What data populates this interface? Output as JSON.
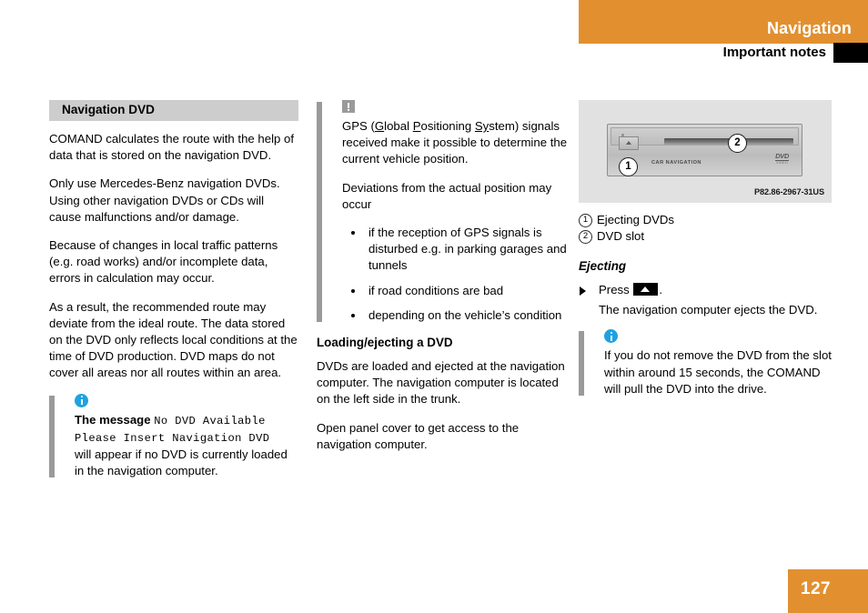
{
  "header": {
    "chapter_title": "Navigation",
    "section_title": "Important notes",
    "accent_color": "#e2902f"
  },
  "columns": {
    "left": {
      "section_band": "Navigation DVD",
      "paragraphs": [
        "COMAND calculates the route with the help of data that is stored on the navigation DVD.",
        "Only use Mercedes-Benz navigation DVDs. Using other navigation DVDs or CDs will cause malfunctions and/or damage.",
        "Because of changes in local traffic patterns (e.g. road works) and/or incomplete data, errors in calculation may occur.",
        "As a result, the recommended route may deviate from the ideal route. The data stored on the DVD only reflects local conditions at the time of DVD production. DVD maps do not cover all areas nor all routes within an area."
      ],
      "info_note": {
        "icon": "info-icon",
        "lead_bold": "The message",
        "message_line_1": "No DVD Available",
        "message_line_2": "Please Insert Navigation DVD",
        "tail": "will appear if no DVD is currently loaded in the navigation computer."
      }
    },
    "middle": {
      "warning_note": {
        "icon": "warning-icon",
        "paragraph_1_pre": "GPS (",
        "paragraph_1_g": "G",
        "paragraph_1_mid1": "lobal ",
        "paragraph_1_p": "P",
        "paragraph_1_mid2": "ositioning ",
        "paragraph_1_s": "Sy",
        "paragraph_1_post": "stem) signals received make it possible to determine the current vehicle position.",
        "paragraph_2": "Deviations from the actual position may occur",
        "bullets": [
          "if the reception of GPS signals is disturbed e.g. in parking garages and tunnels",
          "if road conditions are bad",
          "depending on the vehicle’s condition"
        ]
      },
      "sub_head": "Loading/ejecting a DVD",
      "paragraphs": [
        "DVDs are loaded and ejected at the navigation computer. The navigation computer is located on the left side in the trunk.",
        "Open panel cover to get access to the navigation computer."
      ]
    },
    "right": {
      "figure": {
        "alt": "navigation-computer-front-panel",
        "device_label": "CAR NAVIGATION",
        "dvd_logo_word": "DVD",
        "dvd_logo_sub": "VIDEO",
        "callout_1": "1",
        "callout_2": "2",
        "code": "P82.86-2967-31US"
      },
      "legend": [
        {
          "num": "1",
          "label": "Ejecting DVDs"
        },
        {
          "num": "2",
          "label": "DVD slot"
        }
      ],
      "sub_head": "Ejecting",
      "step": {
        "lead": "Press",
        "key_icon": "eject-key-icon",
        "period": ".",
        "body": "The navigation computer ejects the DVD."
      },
      "info_note": {
        "icon": "info-icon",
        "text": "If you do not remove the DVD from the slot within around 15 seconds, the COMAND will pull the DVD into the drive."
      }
    }
  },
  "footer": {
    "page_number": "127"
  }
}
